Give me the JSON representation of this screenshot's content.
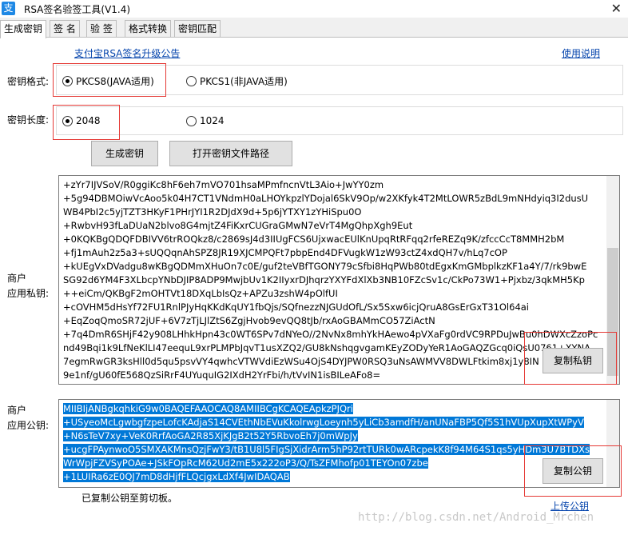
{
  "window": {
    "icon_glyph": "支",
    "title": "RSA签名验签工具(V1.4)",
    "close_glyph": "✕"
  },
  "tabs": [
    {
      "label": "生成密钥"
    },
    {
      "label": "签 名"
    },
    {
      "label": "验 签"
    },
    {
      "label": "格式转换"
    },
    {
      "label": "密钥匹配"
    }
  ],
  "links": {
    "upgrade_notice": "支付宝RSA签名升级公告",
    "help": "使用说明",
    "upload_key": "上传公钥"
  },
  "key_format": {
    "label": "密钥格式:",
    "options": [
      {
        "label": "PKCS8(JAVA适用)",
        "selected": true
      },
      {
        "label": "PKCS1(非JAVA适用)",
        "selected": false
      }
    ]
  },
  "key_length": {
    "label": "密钥长度:",
    "options": [
      {
        "label": "2048",
        "selected": true
      },
      {
        "label": "1024",
        "selected": false
      }
    ]
  },
  "buttons": {
    "generate": "生成密钥",
    "open_path": "打开密钥文件路径",
    "copy_private": "复制私钥",
    "copy_public": "复制公钥"
  },
  "private_key": {
    "label_line1": "商户",
    "label_line2": "应用私钥:",
    "lines": [
      "+zYr7IJVSoV/R0ggiKc8hF6eh7mVO701hsaMPmfncnVtL3Aio+JwYY0zm",
      "+5g94DBMOiwVcAoo5k04H7CT1VNdmH0aLHOYkpzlYDojal6SkV9Op/w2XKfyk4T2MtLOWR5zBdL9mNHdyiq3I2dusU",
      "WB4PbI2c5yjTZT3HKyF1PHrJYI1R2DJdX9d+5p6jYTXY1zYHiSpu0O",
      "+RwbvH93fLaDUaN2blvo8G4mjtZ4FiKxrCUGraGMwN7eVrT4MgQhpXgh9Eut",
      "+0KQKBgQDQFDBIVV6trROQkz8/c2869sJ4d3IIUgFCS6UjxwacEUlKnUpqRtRFqq2rfeREZq9K/zfccCcT8MMH2bM",
      "+fj1mAuh2z5a3+sUQQqnAhSPZ8JR19XJCMPQFt7pbpEnd4DFVugkW1zW93ctZ4xdQH7v/hLq7cOP",
      "+kUEgVxDVadgu8wKBgQDMmXHuOn7c0E/guf2teVBfTGONY79cSfbi8HqPWb80tdEgxKmGMbplkzKF1a4Y/7/rk9bwE",
      "SG92d6YM4F3XLbcpYNbDJIP8ADP9MwjbUv1K2IIyxrDJhqrzYXYFdXlXb3NB10FZcSv1c/CkPo73W1+Pjxbz/3qkMH5Kp",
      "++eiCm/QKBgF2mOHTVt18DXqLbIsQz+APZu3zshW4pOlfUI",
      "+cOVHM5dHsYf72FU1RnlPJyHqKKdKqUY1fbQjs/SQfnezzNJGUdOfL/Sx5Sxw6icjQruA8GsErGxT31Ol64ai",
      "+EqZoqQmoSR72jUF+6V7zTjLJlZtS6ZgjHvob9evQQ8tJb/rxAoGBAMmCO57ZiActN",
      "+7q4DmR6SHjF42y908LHhkHpn43c0WT6SPv7dNYeO//2NvNx8mhYkHAewo4pVXaFg0rdVC9RPDuJwBu0hDWXcZzoPc",
      "nd49Bqi1k9LfNeKlLI47eequL9xrPLMPbJqvT1usXZQ2/GU8kNshqgvgamKEyZODyYeR1AoGAQZGcq0iQsU0761+XYNA",
      "7egmRwGR3ksHll0d5qu5psvVY4qwhcVTWVdiEzWSu4OjS4DYJPW0RSQ3uNsAWMVV8DWLFtkim8xj1y8IN",
      "9e1nf/gU60fE568QzSiRrF4UYuquIG2IXdH2YrFbi/h/tVvIN1isBILeAFo8="
    ]
  },
  "public_key": {
    "label_line1": "商户",
    "label_line2": "应用公钥:",
    "lines": [
      "MIIBIjANBgkqhkiG9w0BAQEFAAOCAQ8AMIIBCgKCAQEApkzPJQri",
      "+USyeoMcLgwbgfzpeLofcKAdjaS14CVEthNbEVuKkolrwgLoeynh5yLiCb3amdfH/anUNaFBP5Qf5S1hVUpXupXtWPyV",
      "+N6sTeV7xy+VeK0RrfAoGA2R85XjKJgB2t52Y5RbvoEh7j0mWpJy",
      "+ucgFPAynwoO5SMXAKMnsQzjFwY3/tB1U8l5FIgSjXidrArm5hP92rtTURk0wARcpekK8f94M64S1qs5yHDm3U7BTDXs",
      "WrWpjFZVSyPOAe+JSkFOpRcM62Ud2mE5x222oP3/Q/TsZFMhofp01TEYOn07zbe",
      "+1LUIRa6zE0QJ7mD8dHjfFLQcjgxLdXf4JwIDAQAB"
    ]
  },
  "status": "已复制公钥至剪切板。",
  "watermark": "http://blog.csdn.net/Android_Mrchen"
}
